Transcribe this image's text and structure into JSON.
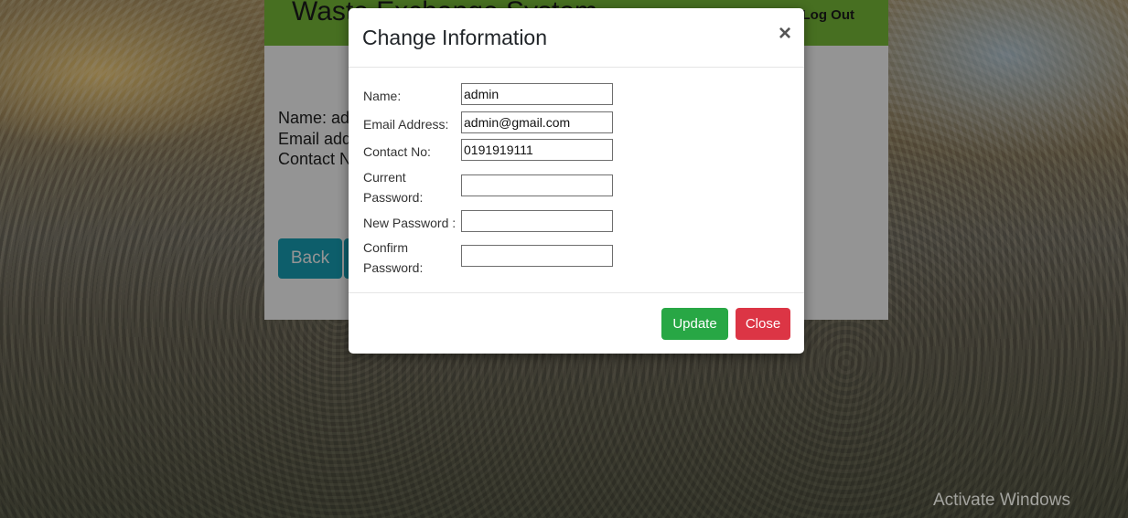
{
  "page": {
    "title": "Waste Exchange System",
    "logout_label": "Log Out",
    "profile": {
      "name_line": "Name: admin",
      "email_line": "Email address: admin@gmail.com",
      "contact_line": "Contact No: 0191919111"
    },
    "back_label": "Back"
  },
  "modal": {
    "title": "Change Information",
    "close_symbol": "×",
    "fields": [
      {
        "label": "Name:",
        "value": "admin"
      },
      {
        "label": "Email Address:",
        "value": "admin@gmail.com"
      },
      {
        "label": "Contact No:",
        "value": "0191919111"
      },
      {
        "label": "Current Password:",
        "value": ""
      },
      {
        "label": "New Password :",
        "value": ""
      },
      {
        "label": "Confirm Password:",
        "value": ""
      }
    ],
    "update_label": "Update",
    "close_label": "Close"
  },
  "watermark": "Activate Windows",
  "colors": {
    "header_green": "#7bbf3a",
    "back_button": "#17a2b8",
    "update_button": "#28a745",
    "close_button": "#dc3545"
  }
}
